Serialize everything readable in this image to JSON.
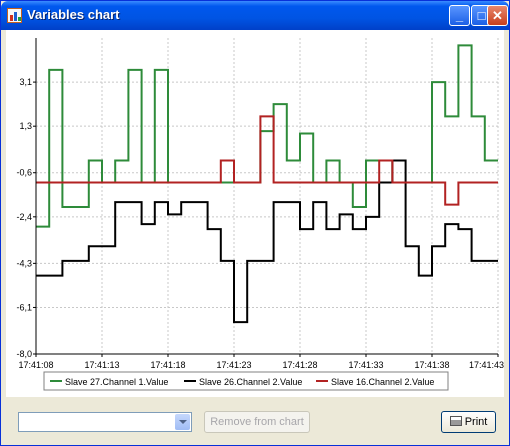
{
  "window": {
    "title": "Variables chart"
  },
  "titlebar_buttons": {
    "minimize": "_",
    "maximize": "□",
    "close": "✕"
  },
  "colors": {
    "series_green": "#2e8b3a",
    "series_black": "#000000",
    "series_red": "#b22222",
    "grid": "#c8c8c8"
  },
  "controls": {
    "combo_value": "",
    "remove_label": "Remove from chart",
    "print_label": "Print"
  },
  "chart_data": {
    "type": "line",
    "step": true,
    "title": "",
    "xlabel": "",
    "ylabel": "",
    "ylim": [
      -8.0,
      4.9
    ],
    "yticks": [
      "3,1",
      "1,3",
      "-0,6",
      "-2,4",
      "-4,3",
      "-6,1",
      "-8,0"
    ],
    "yticks_values": [
      3.1,
      1.3,
      -0.6,
      -2.4,
      -4.3,
      -6.1,
      -8.0
    ],
    "xlim": [
      0,
      35
    ],
    "xticks": [
      "17:41:08",
      "17:41:13",
      "17:41:18",
      "17:41:23",
      "17:41:28",
      "17:41:33",
      "17:41:38",
      "17:41:43"
    ],
    "xticks_values": [
      0,
      5,
      10,
      15,
      20,
      25,
      30,
      35
    ],
    "legend_position": "bottom",
    "series": [
      {
        "name": "Slave 27.Channel 1.Value",
        "color": "#2e8b3a",
        "x": [
          0,
          1,
          2,
          3,
          4,
          5,
          6,
          7,
          8,
          9,
          10,
          11,
          12,
          13,
          14,
          15,
          16,
          17,
          18,
          19,
          20,
          21,
          22,
          23,
          24,
          25,
          26,
          27,
          28,
          29,
          30,
          31,
          32,
          33,
          34,
          35
        ],
        "y": [
          -2.8,
          3.6,
          -2.0,
          -2.0,
          -0.1,
          -1.0,
          -0.1,
          3.6,
          -1.0,
          3.6,
          -1.0,
          -1.0,
          -1.0,
          -1.0,
          -1.0,
          -1.0,
          -1.0,
          1.1,
          2.2,
          -0.1,
          1.0,
          -1.0,
          -0.1,
          -1.0,
          -2.0,
          -0.1,
          -0.1,
          -1.0,
          -1.0,
          -1.0,
          3.1,
          1.7,
          4.6,
          1.7,
          -0.1,
          -0.1
        ]
      },
      {
        "name": "Slave 26.Channel 2.Value",
        "color": "#000000",
        "x": [
          0,
          1,
          2,
          3,
          4,
          5,
          6,
          7,
          8,
          9,
          10,
          11,
          12,
          13,
          14,
          15,
          16,
          17,
          18,
          19,
          20,
          21,
          22,
          23,
          24,
          25,
          26,
          27,
          28,
          29,
          30,
          31,
          32,
          33,
          34,
          35
        ],
        "y": [
          -4.8,
          -4.8,
          -4.2,
          -4.2,
          -3.6,
          -3.6,
          -1.8,
          -1.8,
          -2.7,
          -1.8,
          -2.3,
          -1.8,
          -1.8,
          -2.9,
          -4.2,
          -6.7,
          -4.2,
          -4.2,
          -1.8,
          -1.8,
          -2.9,
          -1.8,
          -2.9,
          -2.3,
          -2.9,
          -2.4,
          -1.0,
          -0.1,
          -3.6,
          -4.8,
          -3.6,
          -2.7,
          -2.9,
          -4.2,
          -4.2,
          -4.2
        ]
      },
      {
        "name": "Slave 16.Channel 2.Value",
        "color": "#b22222",
        "x": [
          0,
          1,
          2,
          3,
          4,
          5,
          6,
          7,
          8,
          9,
          10,
          11,
          12,
          13,
          14,
          15,
          16,
          17,
          18,
          19,
          20,
          21,
          22,
          23,
          24,
          25,
          26,
          27,
          28,
          29,
          30,
          31,
          32,
          33,
          34,
          35
        ],
        "y": [
          -1.0,
          -1.0,
          -1.0,
          -1.0,
          -1.0,
          -1.0,
          -1.0,
          -1.0,
          -1.0,
          -1.0,
          -1.0,
          -1.0,
          -1.0,
          -1.0,
          -0.1,
          -1.0,
          -1.0,
          1.7,
          -1.0,
          -1.0,
          -1.0,
          -1.0,
          -1.0,
          -1.0,
          -1.0,
          -1.0,
          -0.1,
          -1.0,
          -1.0,
          -1.0,
          -1.0,
          -1.9,
          -1.0,
          -1.0,
          -1.0,
          -1.0
        ]
      }
    ]
  }
}
